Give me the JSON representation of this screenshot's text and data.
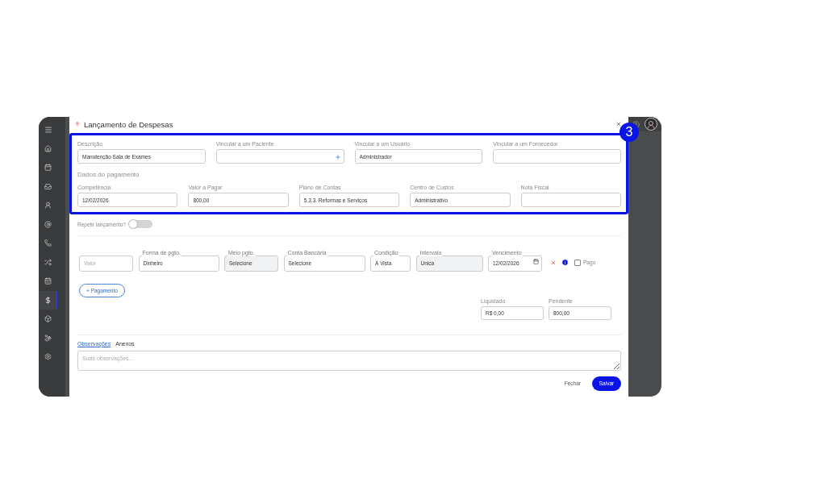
{
  "sidebar": {
    "items": [
      {
        "selected": false
      },
      {
        "selected": false
      },
      {
        "selected": false
      },
      {
        "selected": false
      },
      {
        "selected": false
      },
      {
        "selected": false
      },
      {
        "selected": false
      },
      {
        "selected": false
      },
      {
        "selected": true
      },
      {
        "selected": false
      },
      {
        "selected": false
      },
      {
        "selected": false
      }
    ]
  },
  "modal": {
    "title": "Lançamento de Despesas",
    "annotation": {
      "number": "3"
    },
    "fields": [
      {
        "label": "Descrição",
        "value": "Manutenção Sala de Exames",
        "kind": "text"
      },
      {
        "label": "Vincular a um Paciente",
        "kind": "add"
      },
      {
        "label": "Vincular a um Usuário",
        "value": "Administrador",
        "kind": "text"
      },
      {
        "label": "Vincular a um Fornecedor",
        "kind": "text"
      }
    ],
    "section_title": "Dados do pagamento",
    "payment_fields": [
      {
        "label": "Competência",
        "value": "12/02/2026"
      },
      {
        "label": "Valor a Pagar",
        "value": "800,00"
      },
      {
        "label": "Plano de Contas",
        "value": "5.3.3. Reformas e Serviços"
      },
      {
        "label": "Centro de Custos",
        "value": "Administrativo"
      },
      {
        "label": "Nota Fiscal"
      }
    ],
    "repeat": {
      "label": "Repetir lançamento?",
      "on": false
    },
    "payment_row": [
      {
        "kind": "input",
        "placeholder": "Valor",
        "disabled": false
      },
      {
        "kind": "select",
        "label": "Forma de pgto.",
        "value": "Dinheiro",
        "disabled": false
      },
      {
        "kind": "select",
        "label": "Meio pgto.",
        "value": "Selecione",
        "disabled": true
      },
      {
        "kind": "select",
        "label": "Conta Bancária",
        "value": "Selecione",
        "disabled": false
      },
      {
        "kind": "select",
        "label": "Condição",
        "value": "À Vista",
        "disabled": false
      },
      {
        "kind": "select",
        "label": "Intervalo",
        "value": "Única",
        "disabled": true
      },
      {
        "kind": "date",
        "label": "Vencimento",
        "value": "12/02/2026",
        "disabled": false
      }
    ],
    "paid": {
      "label": "Pago",
      "checked": false
    },
    "add_payment": "+ Pagamento",
    "totals": [
      {
        "label": "Liquidado",
        "value": "R$ 0,00"
      },
      {
        "label": "Pendente",
        "value": "800,00"
      }
    ],
    "tabs": [
      {
        "label": "Observações",
        "selected": true
      },
      {
        "label": "Anexos",
        "selected": false
      }
    ],
    "notes": {
      "placeholder": "Suas observações..."
    },
    "buttons": {
      "close": "Fechar",
      "save": "Salvar"
    }
  }
}
